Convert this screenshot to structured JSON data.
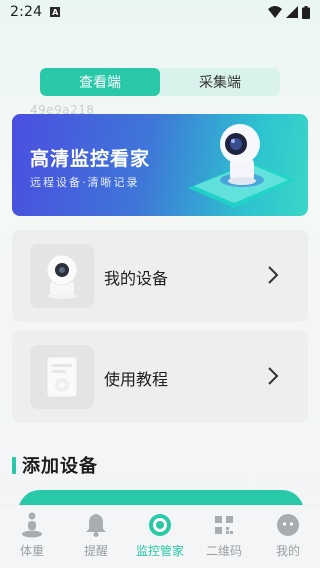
{
  "status_bar": {
    "time": "2:24",
    "notification_letter": "A"
  },
  "segment": {
    "tabs": [
      "查看端",
      "采集端"
    ],
    "active_index": 0
  },
  "device_id": "49e9a218",
  "banner": {
    "title": "高清监控看家",
    "subtitle": "远程设备·清晰记录"
  },
  "cards": [
    {
      "label": "我的设备",
      "icon": "camera-icon"
    },
    {
      "label": "使用教程",
      "icon": "tutorial-icon"
    }
  ],
  "section": {
    "title": "添加设备"
  },
  "tabs": [
    {
      "label": "体重",
      "icon": "person-scale-icon"
    },
    {
      "label": "提醒",
      "icon": "bell-icon"
    },
    {
      "label": "监控管家",
      "icon": "monitor-icon",
      "active": true
    },
    {
      "label": "二维码",
      "icon": "qr-code-icon"
    },
    {
      "label": "我的",
      "icon": "profile-icon"
    }
  ],
  "colors": {
    "accent": "#29c8a8",
    "segment_bg": "#d9f3ec"
  }
}
